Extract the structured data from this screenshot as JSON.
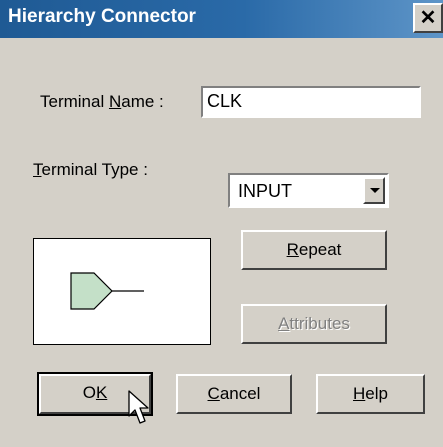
{
  "window": {
    "title": "Hierarchy Connector",
    "close_glyph": "✕"
  },
  "form": {
    "name_label_pre": "Terminal ",
    "name_label_accel": "N",
    "name_label_post": "ame :",
    "name_value": "CLK",
    "type_label_accel": "T",
    "type_label_post": "erminal Type :",
    "type_value": "INPUT"
  },
  "preview": {
    "symbol": "input-terminal-icon",
    "fill_color": "#c4e0c8"
  },
  "buttons": {
    "repeat_accel": "R",
    "repeat_rest": "epeat",
    "attributes_accel": "A",
    "attributes_rest": "ttributes",
    "ok_pre": "O",
    "ok_accel": "K",
    "cancel_accel": "C",
    "cancel_rest": "ancel",
    "help_accel": "H",
    "help_rest": "elp"
  },
  "colors": {
    "titlebar": "#1f5a94",
    "face": "#d4d0c8"
  }
}
